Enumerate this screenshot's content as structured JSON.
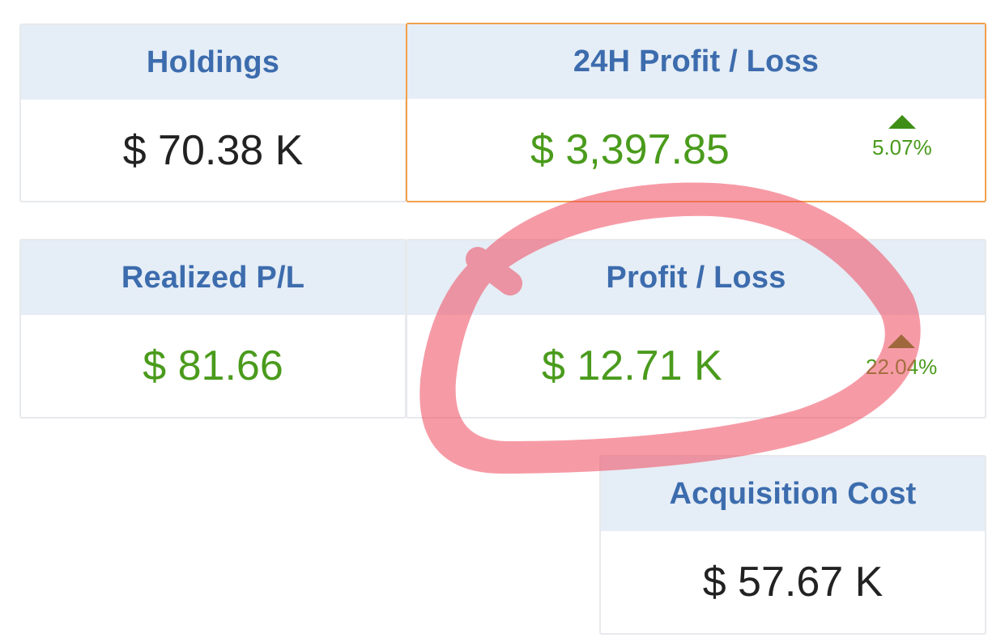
{
  "cards": {
    "holdings": {
      "title": "Holdings",
      "value": "$ 70.38 K"
    },
    "pl_24h": {
      "title": "24H Profit / Loss",
      "value": "$ 3,397.85",
      "change": "5.07%",
      "direction": "up-arrow-icon"
    },
    "realized": {
      "title": "Realized P/L",
      "value": "$ 81.66"
    },
    "profit_loss": {
      "title": "Profit / Loss",
      "value": "$ 12.71 K",
      "change": "22.04%",
      "direction": "up-arrow-icon"
    },
    "acquisition": {
      "title": "Acquisition Cost",
      "value": "$ 57.67 K"
    }
  },
  "colors": {
    "header_bg": "#e5edf6",
    "header_text": "#3c6cad",
    "positive": "#4a9b1c",
    "active_border": "#f0a04b",
    "annotation": "#f04a5e"
  }
}
